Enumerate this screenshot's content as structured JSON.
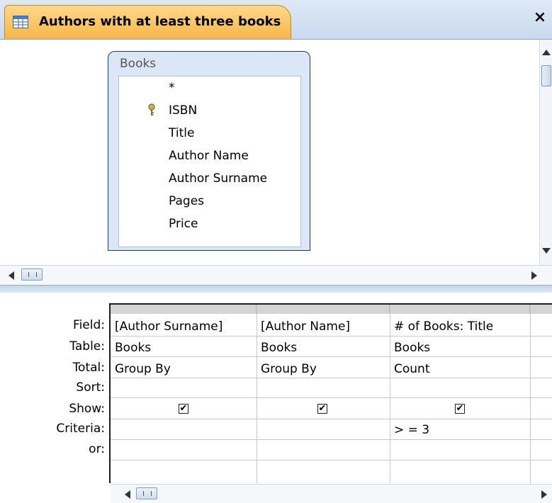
{
  "window": {
    "tab_title": "Authors with at least three books",
    "close_label": "×",
    "tab_icon": "query-icon",
    "accent": "#f7b64a"
  },
  "table_pane": {
    "table": {
      "name": "Books",
      "fields": [
        "*",
        "ISBN",
        "Title",
        "Author Name",
        "Author Surname",
        "Pages",
        "Price"
      ],
      "primary_key": "ISBN"
    }
  },
  "grid": {
    "row_labels": [
      "Field:",
      "Table:",
      "Total:",
      "Sort:",
      "Show:",
      "Criteria:",
      "or:"
    ],
    "columns": [
      {
        "field": "[Author Surname]",
        "table": "Books",
        "total": "Group By",
        "sort": "",
        "show": true,
        "criteria": "",
        "or": ""
      },
      {
        "field": "[Author Name]",
        "table": "Books",
        "total": "Group By",
        "sort": "",
        "show": true,
        "criteria": "",
        "or": ""
      },
      {
        "field": "# of Books: Title",
        "table": "Books",
        "total": "Count",
        "sort": "",
        "show": true,
        "criteria": "> = 3",
        "or": ""
      }
    ],
    "check_glyph": "✔"
  }
}
